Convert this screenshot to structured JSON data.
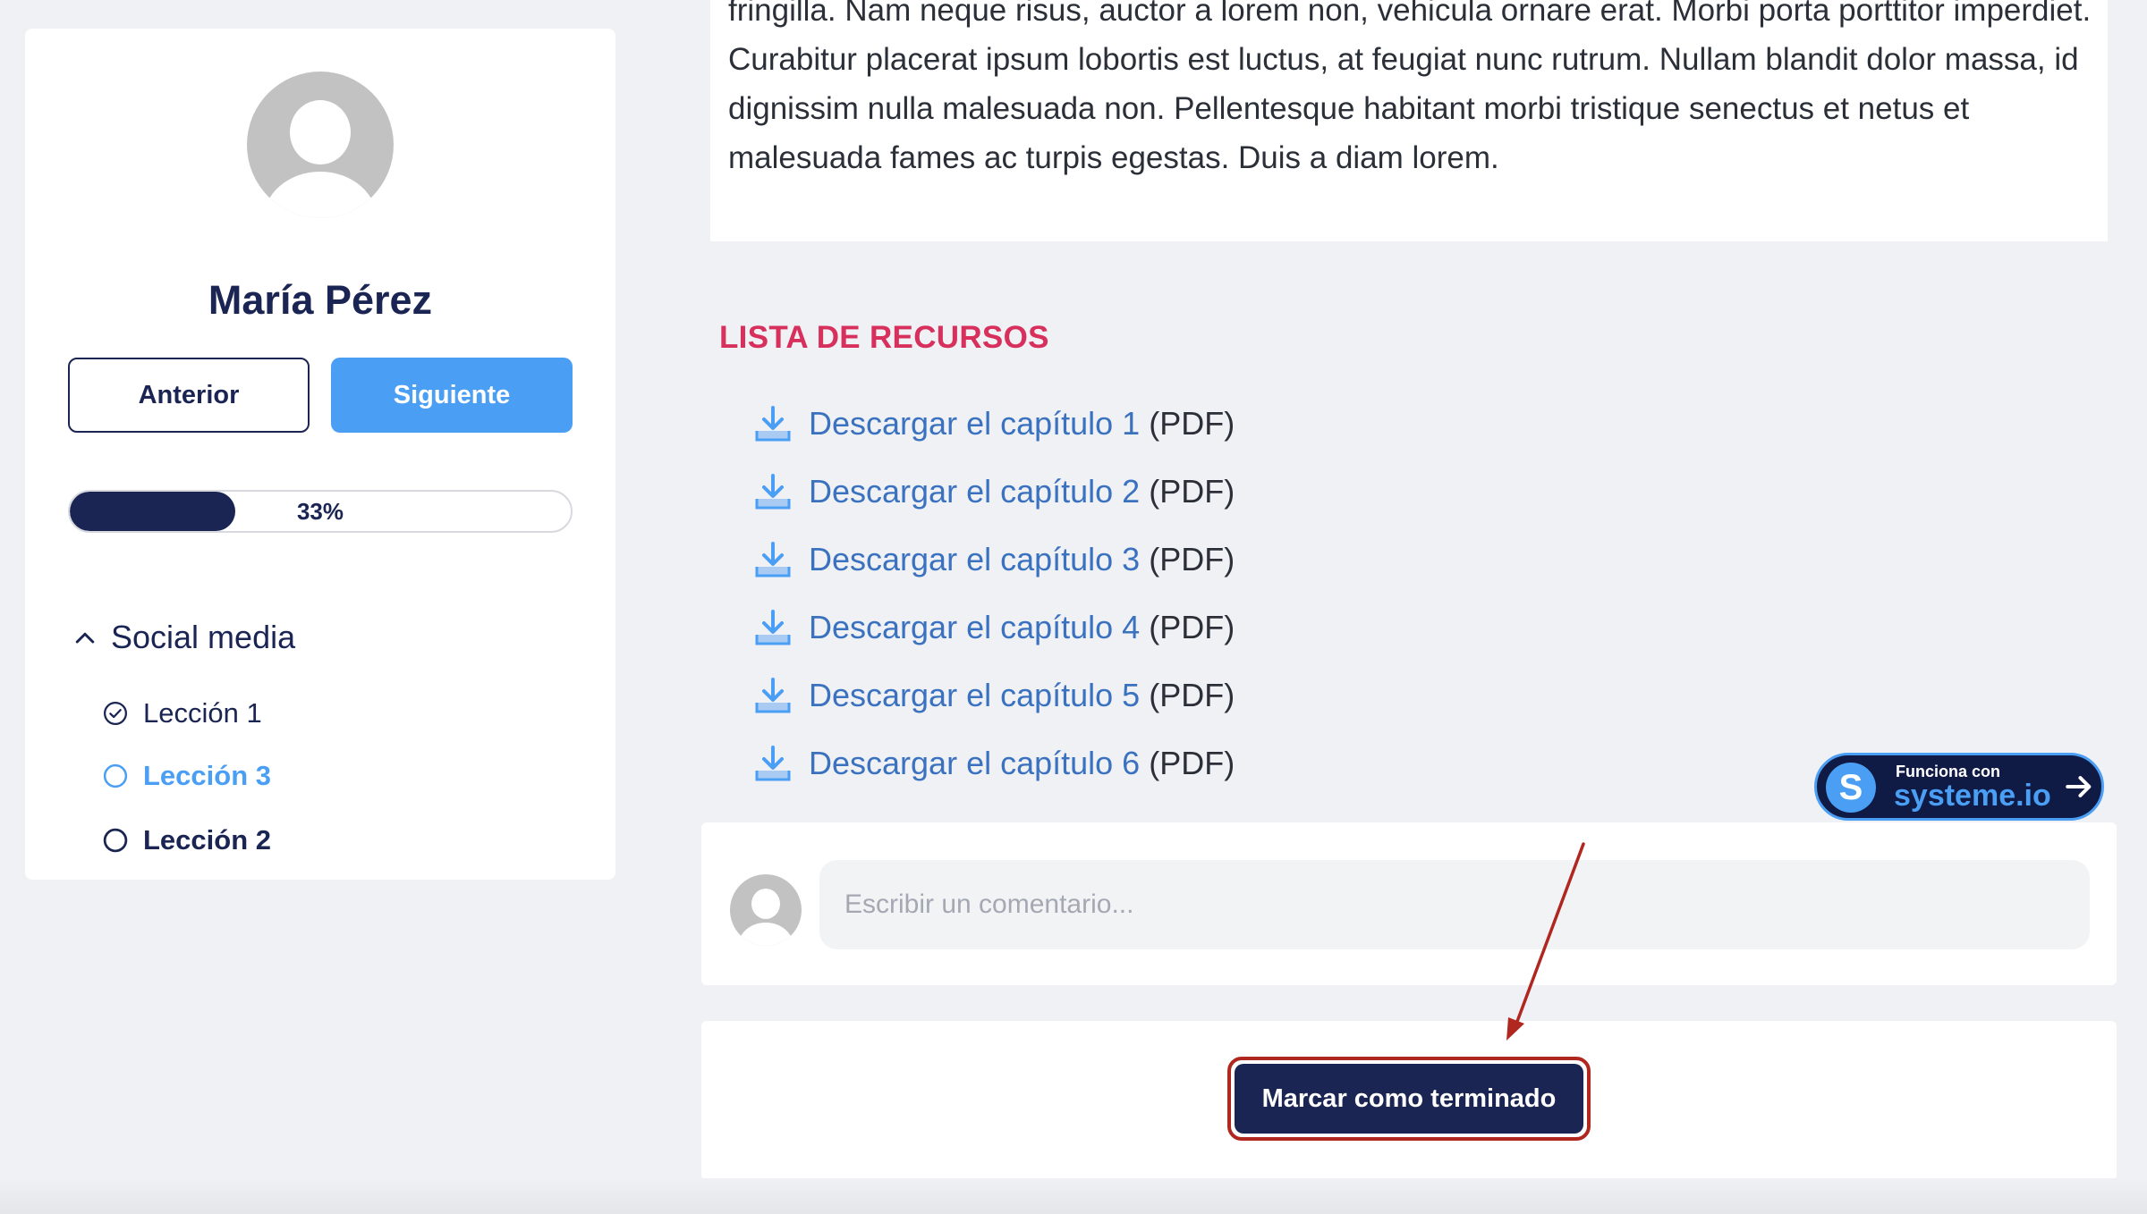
{
  "sidebar": {
    "user_name": "María Pérez",
    "prev_label": "Anterior",
    "next_label": "Siguiente",
    "progress": {
      "percent": 33,
      "label": "33%"
    },
    "module": {
      "title": "Social media",
      "expanded": true,
      "lessons": [
        {
          "label": "Lección 1",
          "state": "completed"
        },
        {
          "label": "Lección 3",
          "state": "current"
        },
        {
          "label": "Lección 2",
          "state": "pending"
        }
      ]
    }
  },
  "content": {
    "paragraph_visible": "fringilla. Nam neque risus, auctor a lorem non, vehicula ornare erat. Morbi porta porttitor imperdiet. Curabitur placerat ipsum lobortis est luctus, at feugiat nunc rutrum. Nullam blandit dolor massa, id dignissim nulla malesuada non. Pellentesque habitant morbi tristique senectus et netus et malesuada fames ac turpis egestas. Duis a diam lorem.",
    "resources_title": "LISTA DE RECURSOS",
    "resources": [
      {
        "link": "Descargar el capítulo 1",
        "suffix": "(PDF)"
      },
      {
        "link": "Descargar el capítulo 2",
        "suffix": "(PDF)"
      },
      {
        "link": "Descargar el capítulo 3",
        "suffix": "(PDF)"
      },
      {
        "link": "Descargar el capítulo 4",
        "suffix": "(PDF)"
      },
      {
        "link": "Descargar el capítulo 5",
        "suffix": "(PDF)"
      },
      {
        "link": "Descargar el capítulo 6",
        "suffix": "(PDF)"
      }
    ]
  },
  "badge": {
    "letter": "S",
    "small_text": "Funciona con",
    "brand": "systeme.io"
  },
  "comment": {
    "placeholder": "Escribir un comentario..."
  },
  "finish": {
    "label": "Marcar como terminado"
  },
  "colors": {
    "navy": "#1b2553",
    "accent_blue": "#4a9ff5",
    "resources_title": "#d7305c",
    "link": "#3a72c0",
    "annotation": "#b0271f"
  },
  "icons": {
    "avatar": "user-silhouette-icon",
    "collapse": "chevron-up-icon",
    "completed": "check-circle-icon",
    "pending": "circle-icon",
    "download": "download-icon",
    "badge_arrow": "arrow-right-icon"
  }
}
